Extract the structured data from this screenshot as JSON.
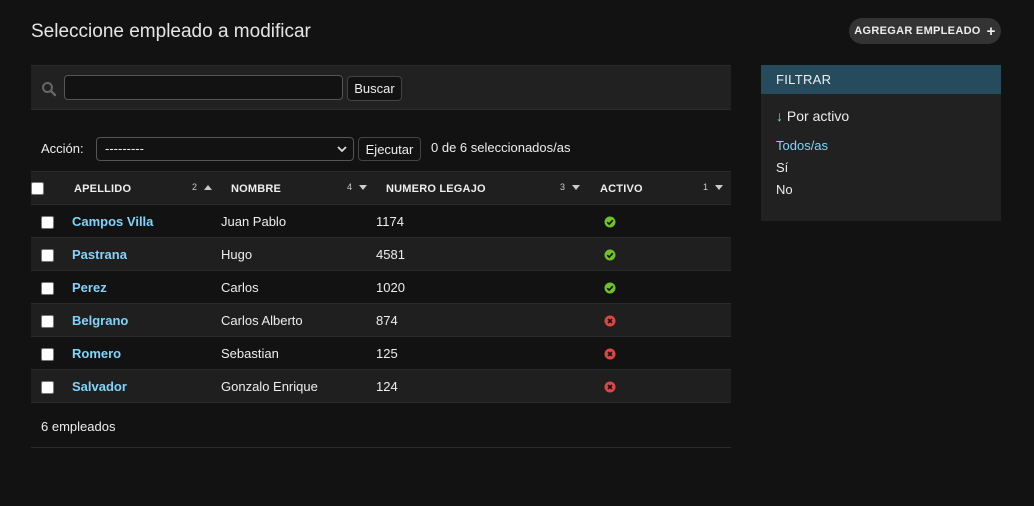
{
  "page": {
    "title": "Seleccione empleado a modificar",
    "add_button_label": "AGREGAR EMPLEADO",
    "add_button_icon": "+"
  },
  "search": {
    "value": "",
    "placeholder": "",
    "button_label": "Buscar"
  },
  "actions": {
    "label": "Acción:",
    "selected": "---------",
    "execute_label": "Ejecutar",
    "counter": "0 de 6 seleccionados/as"
  },
  "table": {
    "columns": [
      {
        "label": "APELLIDO",
        "sort_priority": "2",
        "sort_dir": "asc"
      },
      {
        "label": "NOMBRE",
        "sort_priority": "4",
        "sort_dir": "desc"
      },
      {
        "label": "NUMERO LEGAJO",
        "sort_priority": "3",
        "sort_dir": "desc"
      },
      {
        "label": "ACTIVO",
        "sort_priority": "1",
        "sort_dir": "desc"
      }
    ],
    "rows": [
      {
        "apellido": "Campos Villa",
        "nombre": "Juan Pablo",
        "legajo": "1174",
        "activo": true
      },
      {
        "apellido": "Pastrana",
        "nombre": "Hugo",
        "legajo": "4581",
        "activo": true
      },
      {
        "apellido": "Perez",
        "nombre": "Carlos",
        "legajo": "1020",
        "activo": true
      },
      {
        "apellido": "Belgrano",
        "nombre": "Carlos Alberto",
        "legajo": "874",
        "activo": false
      },
      {
        "apellido": "Romero",
        "nombre": "Sebastian",
        "legajo": "125",
        "activo": false
      },
      {
        "apellido": "Salvador",
        "nombre": "Gonzalo Enrique",
        "legajo": "124",
        "activo": false
      }
    ]
  },
  "paginator": {
    "text": "6 empleados"
  },
  "filter": {
    "title": "FILTRAR",
    "section_arrow": "↓",
    "section_title": "Por activo",
    "options": [
      "Todos/as",
      "Sí",
      "No"
    ]
  },
  "colors": {
    "link": "#81d4fa",
    "yes_icon": "#70bf2b",
    "no_icon": "#dd4646",
    "filter_header_bg": "#264b5d"
  }
}
